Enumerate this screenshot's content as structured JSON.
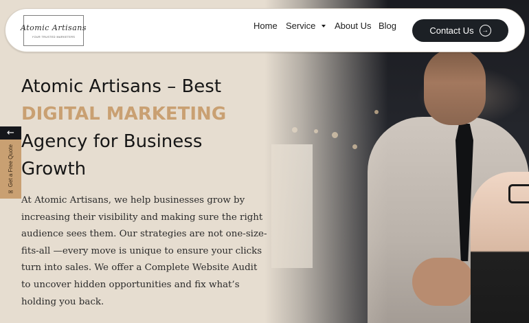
{
  "header": {
    "logo": {
      "script": "Atomic Artisans",
      "tagline": "YOUR TRUSTED MARKETERS"
    },
    "nav": [
      {
        "label": "Home"
      },
      {
        "label": "Service",
        "has_dropdown": true
      },
      {
        "label": "About Us"
      },
      {
        "label": "Blog"
      }
    ],
    "contact_label": "Contact Us",
    "contact_icon": "arrow-right-circle-icon"
  },
  "hero": {
    "headline_line1": "Atomic Artisans – Best",
    "headline_accent": "DIGITAL MARKETING",
    "headline_line3": "Agency for Business",
    "headline_line4": "Growth",
    "body": "At Atomic Artisans, we help businesses grow by increasing their visibility and making sure the right audience sees them. Our strategies are not one-size-fits-all —every move is unique to ensure your clicks turn into sales. We offer a Complete Website Audit to uncover hidden opportunities and fix what’s holding you back."
  },
  "side_tab": {
    "arrow": "←",
    "label": "Get a Free Quote",
    "icon": "envelope-icon"
  },
  "colors": {
    "accent": "#c9a072",
    "dark": "#1c2025",
    "background": "#e6ddd0"
  }
}
